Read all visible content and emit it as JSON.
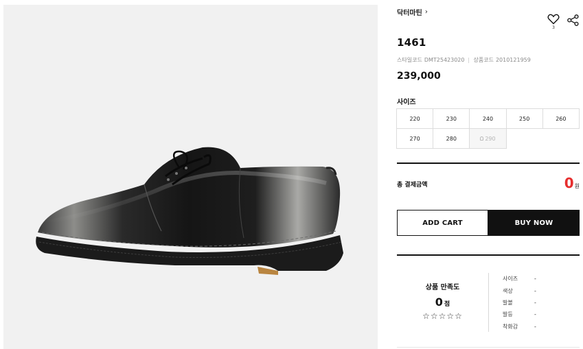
{
  "product": {
    "brand": "닥터마틴",
    "brand_chevron": "›",
    "wish_count": "3",
    "name": "1461",
    "style_code_label": "스타일코드",
    "style_code": "DMT25423020",
    "product_code_label": "상품코드",
    "product_code": "2010121959",
    "price": "239,000"
  },
  "sizes": {
    "label": "사이즈",
    "options": [
      {
        "value": "220",
        "available": true
      },
      {
        "value": "230",
        "available": true
      },
      {
        "value": "240",
        "available": true
      },
      {
        "value": "250",
        "available": true
      },
      {
        "value": "260",
        "available": true
      },
      {
        "value": "270",
        "available": true
      },
      {
        "value": "280",
        "available": true
      },
      {
        "value": "290",
        "available": false
      }
    ]
  },
  "total": {
    "label": "총 결제금액",
    "amount": "0",
    "unit": "원"
  },
  "buttons": {
    "add_cart": "ADD CART",
    "buy_now": "BUY NOW"
  },
  "satisfaction": {
    "label": "상품 만족도",
    "score": "0",
    "score_unit": "점",
    "stars": "☆☆☆☆☆",
    "rating": 0,
    "attributes": [
      {
        "name": "사이즈",
        "value": "-"
      },
      {
        "name": "색상",
        "value": "-"
      },
      {
        "name": "발볼",
        "value": "-"
      },
      {
        "name": "발등",
        "value": "-"
      },
      {
        "name": "착화감",
        "value": "-"
      }
    ]
  },
  "icons": {
    "wishlist": "heart-icon",
    "share": "share-icon",
    "restock": "bell-icon"
  }
}
